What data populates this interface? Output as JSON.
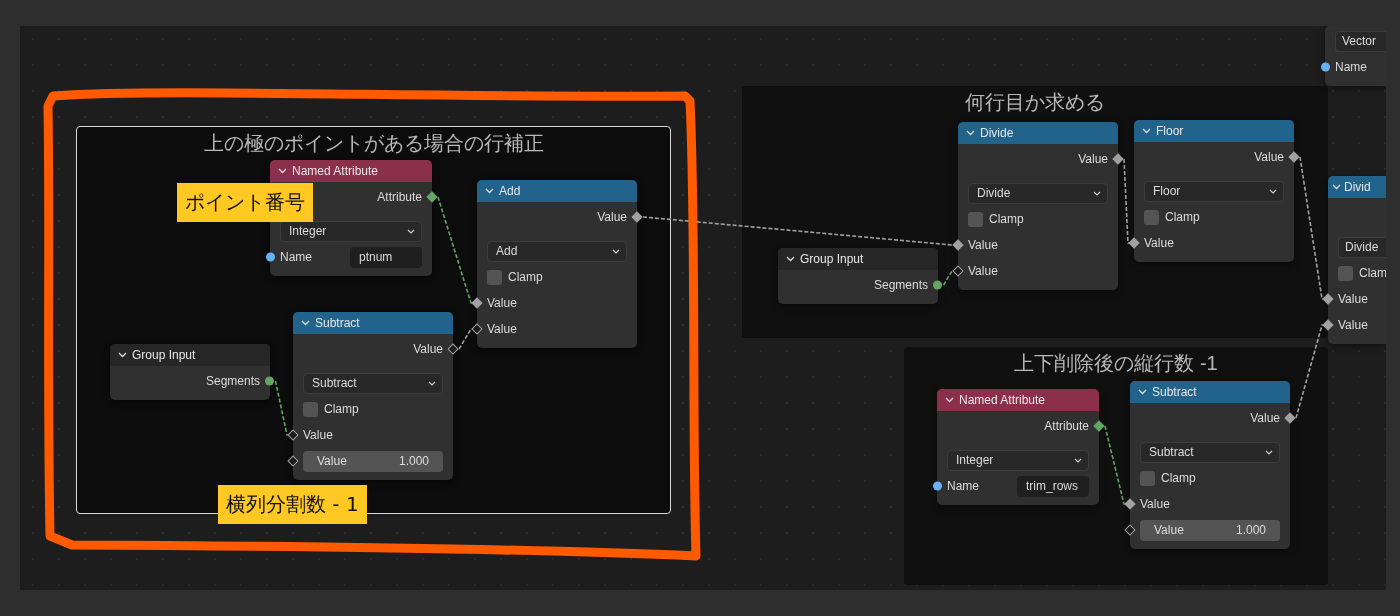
{
  "frames": [
    {
      "title": "上の極のポイントがある場合の行補正",
      "selected": true
    },
    {
      "title": "何行目か求める",
      "selected": false
    },
    {
      "title": "上下削除後の縦行数 -1",
      "selected": false
    }
  ],
  "nodes": [
    {
      "title": "Named Attribute",
      "color": "#8b2f4d",
      "rows": [
        {
          "kind": "output",
          "label": "Attribute",
          "socket": {
            "kind": "diamond",
            "color": "#63a563"
          }
        },
        {
          "kind": "dropdown",
          "value": "Integer"
        },
        {
          "kind": "field",
          "label": "Name",
          "value": "ptnum",
          "socket": {
            "kind": "circle",
            "color": "#6ab0f5"
          }
        }
      ]
    },
    {
      "title": "Add",
      "color": "#21638a",
      "rows": [
        {
          "kind": "output",
          "label": "Value",
          "socket": {
            "kind": "diamond",
            "color": "#a1a1a1"
          }
        },
        {
          "kind": "dropdown",
          "value": "Add"
        },
        {
          "kind": "checkbox",
          "label": "Clamp",
          "checked": false
        },
        {
          "kind": "input",
          "label": "Value",
          "socket": {
            "kind": "diamond",
            "color": "#a1a1a1"
          }
        },
        {
          "kind": "input",
          "label": "Value",
          "socket": {
            "kind": "hollow",
            "color": "#a1a1a1"
          }
        }
      ]
    },
    {
      "title": "Group Input",
      "color": "#262626",
      "rows": [
        {
          "kind": "output",
          "label": "Segments",
          "socket": {
            "kind": "circle",
            "color": "#63a563"
          }
        }
      ]
    },
    {
      "title": "Subtract",
      "color": "#21638a",
      "rows": [
        {
          "kind": "output",
          "label": "Value",
          "socket": {
            "kind": "hollow",
            "color": "#a1a1a1"
          }
        },
        {
          "kind": "dropdown",
          "value": "Subtract"
        },
        {
          "kind": "checkbox",
          "label": "Clamp",
          "checked": false
        },
        {
          "kind": "input",
          "label": "Value",
          "socket": {
            "kind": "hollow",
            "color": "#a1a1a1"
          }
        },
        {
          "kind": "number",
          "label": "Value",
          "value": "1.000",
          "socket": {
            "kind": "hollow",
            "color": "#a1a1a1"
          }
        }
      ]
    },
    {
      "title": "Divide",
      "color": "#21638a",
      "rows": [
        {
          "kind": "output",
          "label": "Value",
          "socket": {
            "kind": "diamond",
            "color": "#a1a1a1"
          }
        },
        {
          "kind": "dropdown",
          "value": "Divide"
        },
        {
          "kind": "checkbox",
          "label": "Clamp",
          "checked": false
        },
        {
          "kind": "input",
          "label": "Value",
          "socket": {
            "kind": "diamond",
            "color": "#a1a1a1"
          }
        },
        {
          "kind": "input",
          "label": "Value",
          "socket": {
            "kind": "hollow",
            "color": "#a1a1a1"
          }
        }
      ]
    },
    {
      "title": "Floor",
      "color": "#21638a",
      "rows": [
        {
          "kind": "output",
          "label": "Value",
          "socket": {
            "kind": "diamond",
            "color": "#a1a1a1"
          }
        },
        {
          "kind": "dropdown",
          "value": "Floor"
        },
        {
          "kind": "checkbox",
          "label": "Clamp",
          "checked": false
        },
        {
          "kind": "input",
          "label": "Value",
          "socket": {
            "kind": "diamond",
            "color": "#a1a1a1"
          }
        }
      ]
    },
    {
      "title": "Group Input",
      "color": "#262626",
      "rows": [
        {
          "kind": "output",
          "label": "Segments",
          "socket": {
            "kind": "circle",
            "color": "#63a563"
          }
        }
      ]
    },
    {
      "rows": [
        {
          "kind": "dropdown",
          "value": "Vector"
        },
        {
          "kind": "input",
          "label": "Name",
          "socket": {
            "kind": "circle",
            "color": "#6ab0f5"
          }
        }
      ]
    },
    {
      "title": "Divid",
      "color": "#21638a",
      "rows": [
        {
          "kind": "gap"
        },
        {
          "kind": "dropdown",
          "value": "Divide"
        },
        {
          "kind": "checkbox",
          "label": "Clam",
          "checked": false
        },
        {
          "kind": "input",
          "label": "Value",
          "socket": {
            "kind": "diamond",
            "color": "#a1a1a1"
          }
        },
        {
          "kind": "input",
          "label": "Value",
          "socket": {
            "kind": "diamond",
            "color": "#a1a1a1"
          }
        }
      ]
    },
    {
      "title": "Named Attribute",
      "color": "#8b2f4d",
      "rows": [
        {
          "kind": "output",
          "label": "Attribute",
          "socket": {
            "kind": "diamond",
            "color": "#63a563"
          }
        },
        {
          "kind": "dropdown",
          "value": "Integer"
        },
        {
          "kind": "field",
          "label": "Name",
          "value": "trim_rows",
          "socket": {
            "kind": "circle",
            "color": "#6ab0f5"
          }
        }
      ]
    },
    {
      "title": "Subtract",
      "color": "#21638a",
      "rows": [
        {
          "kind": "output",
          "label": "Value",
          "socket": {
            "kind": "diamond",
            "color": "#a1a1a1"
          }
        },
        {
          "kind": "dropdown",
          "value": "Subtract"
        },
        {
          "kind": "checkbox",
          "label": "Clamp",
          "checked": false
        },
        {
          "kind": "input",
          "label": "Value",
          "socket": {
            "kind": "diamond",
            "color": "#a1a1a1"
          }
        },
        {
          "kind": "number",
          "label": "Value",
          "value": "1.000",
          "socket": {
            "kind": "hollow",
            "color": "#a1a1a1"
          }
        }
      ]
    }
  ],
  "notes": [
    {
      "text": "ポイント番号"
    },
    {
      "text": "横列分割数 - 1"
    }
  ]
}
